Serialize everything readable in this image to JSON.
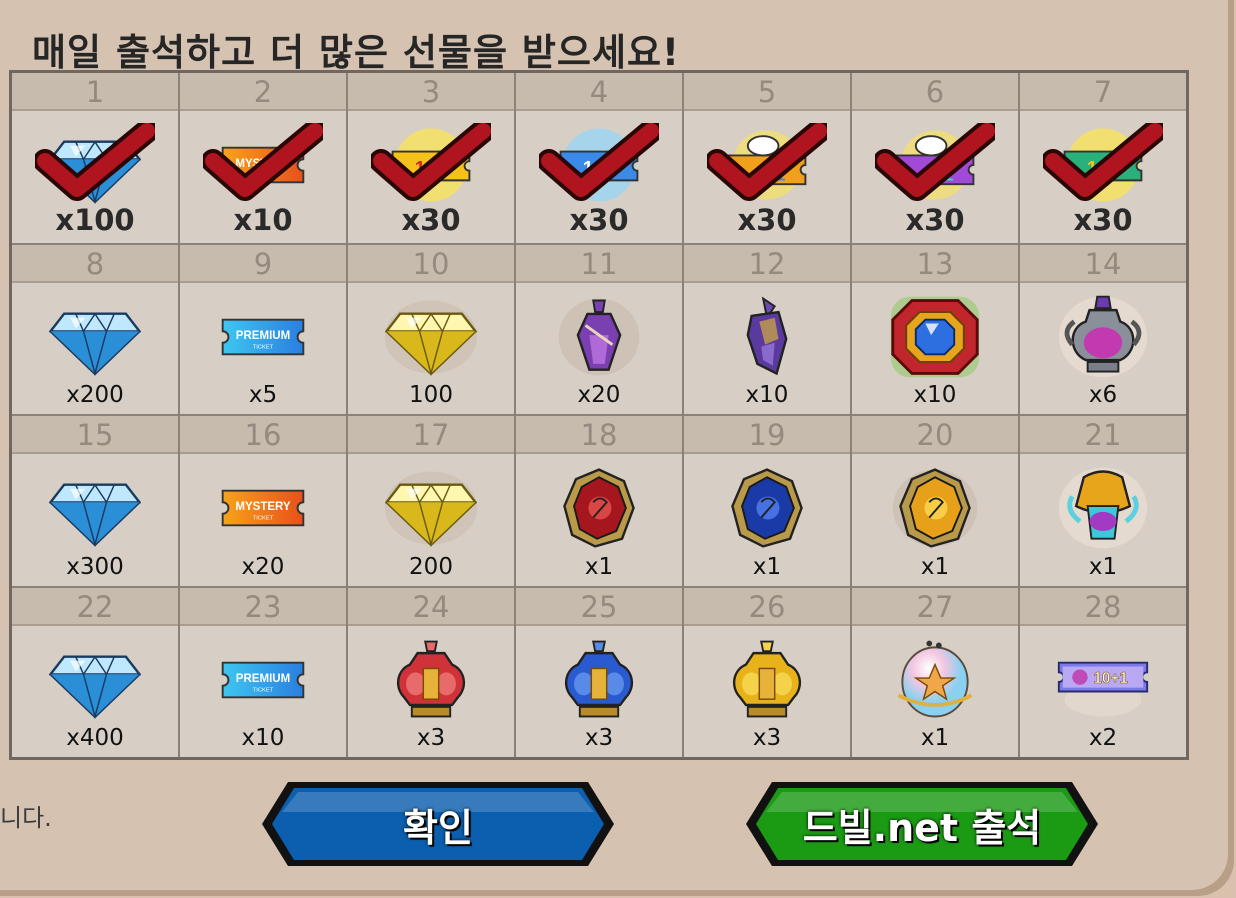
{
  "title": "매일 출석하고 더 많은 선물을 받으세요!",
  "footer_text": "니다.",
  "buttons": {
    "confirm_label": "확인",
    "dvil_label": "드빌.net 출석",
    "confirm_color": "#0b5fae",
    "dvil_color": "#1b9a14"
  },
  "days": [
    {
      "day": "1",
      "qty": "x100",
      "icon": "diamond-icon",
      "claimed": true
    },
    {
      "day": "2",
      "qty": "x10",
      "icon": "mystery-ticket-icon",
      "claimed": true
    },
    {
      "day": "3",
      "qty": "x30",
      "icon": "gold-1plus1-ticket-icon",
      "claimed": true
    },
    {
      "day": "4",
      "qty": "x30",
      "icon": "blue-1plus1-ticket-icon",
      "claimed": true
    },
    {
      "day": "5",
      "qty": "x30",
      "icon": "angel-ticket-icon",
      "claimed": true
    },
    {
      "day": "6",
      "qty": "x30",
      "icon": "purple-angel-ticket-icon",
      "claimed": true
    },
    {
      "day": "7",
      "qty": "x30",
      "icon": "premium-1plus1-ticket-icon",
      "claimed": true
    },
    {
      "day": "8",
      "qty": "x200",
      "icon": "diamond-icon",
      "claimed": false
    },
    {
      "day": "9",
      "qty": "x5",
      "icon": "premium-ticket-icon",
      "claimed": false
    },
    {
      "day": "10",
      "qty": "100",
      "icon": "gold-diamond-icon",
      "claimed": false
    },
    {
      "day": "11",
      "qty": "x20",
      "icon": "small-potion-icon",
      "claimed": false
    },
    {
      "day": "12",
      "qty": "x10",
      "icon": "crystal-shard-icon",
      "claimed": false
    },
    {
      "day": "13",
      "qty": "x10",
      "icon": "red-gem-frame-icon",
      "claimed": false
    },
    {
      "day": "14",
      "qty": "x6",
      "icon": "purple-urn-icon",
      "claimed": false
    },
    {
      "day": "15",
      "qty": "x300",
      "icon": "diamond-icon",
      "claimed": false
    },
    {
      "day": "16",
      "qty": "x20",
      "icon": "mystery-ticket-icon",
      "claimed": false
    },
    {
      "day": "17",
      "qty": "200",
      "icon": "gold-diamond-icon",
      "claimed": false
    },
    {
      "day": "18",
      "qty": "x1",
      "icon": "red-rune-stone-icon",
      "claimed": false
    },
    {
      "day": "19",
      "qty": "x1",
      "icon": "blue-rune-stone-icon",
      "claimed": false
    },
    {
      "day": "20",
      "qty": "x1",
      "icon": "gold-rune-stone-icon",
      "claimed": false
    },
    {
      "day": "21",
      "qty": "x1",
      "icon": "winged-helmet-icon",
      "claimed": false
    },
    {
      "day": "22",
      "qty": "x400",
      "icon": "diamond-icon",
      "claimed": false
    },
    {
      "day": "23",
      "qty": "x10",
      "icon": "premium-ticket-icon",
      "claimed": false
    },
    {
      "day": "24",
      "qty": "x3",
      "icon": "red-urn-icon",
      "claimed": false
    },
    {
      "day": "25",
      "qty": "x3",
      "icon": "blue-urn-icon",
      "claimed": false
    },
    {
      "day": "26",
      "qty": "x3",
      "icon": "gold-urn-icon",
      "claimed": false
    },
    {
      "day": "27",
      "qty": "x1",
      "icon": "rainbow-egg-icon",
      "claimed": false
    },
    {
      "day": "28",
      "qty": "x2",
      "icon": "10plus1-ticket-icon",
      "claimed": false
    }
  ],
  "icon_labels": {
    "premium": "PREMIUM",
    "mystery": "MYSTERY",
    "ticket": "TICKET"
  }
}
